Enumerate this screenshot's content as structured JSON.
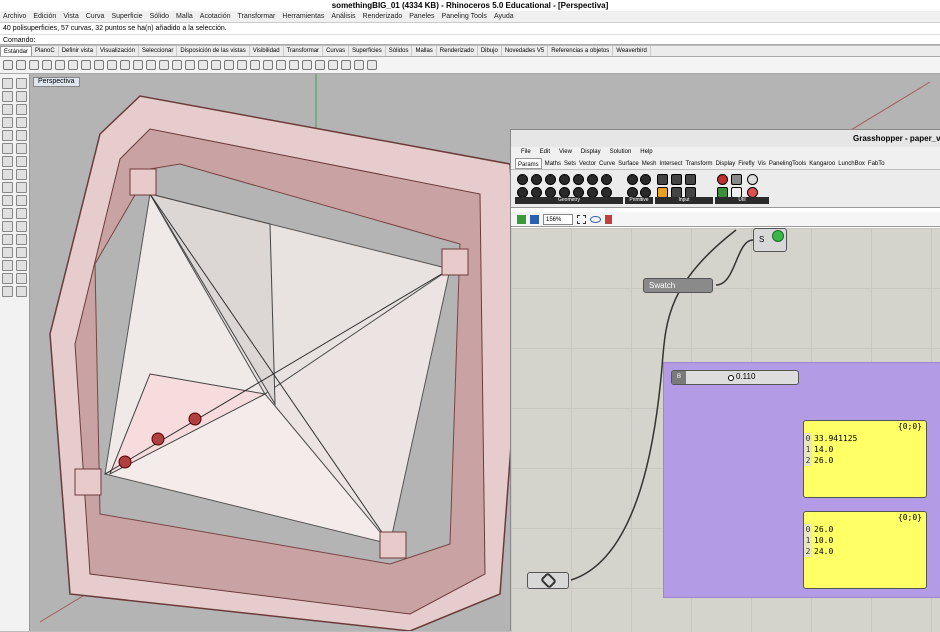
{
  "window": {
    "title": "somethingBIG_01 (4334 KB) - Rhinoceros 5.0 Educational - [Perspectiva]"
  },
  "menu": [
    "Archivo",
    "Edición",
    "Vista",
    "Curva",
    "Superficie",
    "Sólido",
    "Malla",
    "Acotación",
    "Transformar",
    "Herramientas",
    "Análisis",
    "Renderizado",
    "Paneles",
    "Paneling Tools",
    "Ayuda"
  ],
  "command_history": "40 polisuperficies, 57 curvas, 32 puntos se ha(n) añadido a la selección.",
  "command_prompt": "Comando:",
  "toolbar_tabs": [
    "Estándar",
    "PlanoC",
    "Definir vista",
    "Visualización",
    "Seleccionar",
    "Disposición de las vistas",
    "Visibilidad",
    "Transformar",
    "Curvas",
    "Superficies",
    "Sólidos",
    "Mallas",
    "Renderizado",
    "Dibujo",
    "Novedades V5",
    "Referencias a objetos",
    "Weaverbird"
  ],
  "viewport_label": "Perspectiva",
  "grasshopper": {
    "title": "Grasshopper - paper_va",
    "menu": [
      "File",
      "Edit",
      "View",
      "Display",
      "Solution",
      "Help"
    ],
    "tabs": [
      "Params",
      "Maths",
      "Sets",
      "Vector",
      "Curve",
      "Surface",
      "Mesh",
      "Intersect",
      "Transform",
      "Display",
      "Firefly",
      "Vis",
      "PanelingTools",
      "Kangaroo",
      "LunchBox",
      "FabTo"
    ],
    "ribbon_groups": [
      "Geometry",
      "Primitive",
      "Input",
      "Util"
    ],
    "zoom": "156%",
    "swatch_label": "Swatch",
    "s_node_label": "S",
    "slider": {
      "tag": "B",
      "value": "0.110"
    },
    "panels": [
      {
        "header": "{0;0}",
        "rows": [
          {
            "i": "0",
            "v": "33.941125"
          },
          {
            "i": "1",
            "v": "14.0"
          },
          {
            "i": "2",
            "v": "26.0"
          }
        ]
      },
      {
        "header": "{0;0}",
        "rows": [
          {
            "i": "0",
            "v": "26.0"
          },
          {
            "i": "1",
            "v": "10.0"
          },
          {
            "i": "2",
            "v": "24.0"
          }
        ]
      }
    ]
  }
}
